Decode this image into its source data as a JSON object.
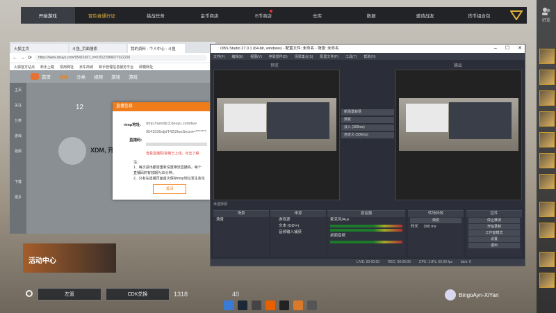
{
  "game_nav": {
    "items": [
      {
        "label": "开始游戏",
        "active": true
      },
      {
        "label": "冒险者通行证",
        "gold": true
      },
      {
        "label": "挑战任务"
      },
      {
        "label": "金币商店"
      },
      {
        "label": "E币商店",
        "badge": true
      },
      {
        "label": "仓库"
      },
      {
        "label": "数据"
      },
      {
        "label": "邀请战友"
      },
      {
        "label": "货币组合包"
      }
    ]
  },
  "right_sidebar": {
    "friend_label": "好友"
  },
  "browser": {
    "tabs": [
      "火狐主页",
      "斗鱼_页面搜索",
      "我的资料 - 个人中心 - 斗鱼"
    ],
    "url": "https://www.douyu.com/9541536?_rt=0.8122966677022226",
    "bookmarks": [
      "火狐官方站点",
      "新手上路",
      "常用网址",
      "京东商城",
      "新手管理信息服务平台",
      "即模网址"
    ],
    "douyu_nav": [
      "首页",
      "直播",
      "分类",
      "视频",
      "游戏",
      "游戏"
    ],
    "side_items": [
      "主页",
      "关注",
      "分类",
      "游戏",
      "视频",
      "",
      "下载",
      "更多"
    ],
    "level": "12",
    "streamer": "XDM, 开",
    "modal": {
      "title": "直播信息",
      "rtmp_label": "rtmp地址:",
      "rtmp_value": "rtmp://sendtc3.douyu.com/live",
      "key_label": "直播码:",
      "key_value": "9541536rdjdT4Zi2lwsSecret=*******",
      "hint": "查看直播码/复制已上线，点击了解",
      "note_title": "注:",
      "notes": [
        "1、每次进出都需重新设置推流直播码，每个",
        "直播码的有效期为15分钟。",
        "2、只有在直播页面首次保存rtmp地址发生变化"
      ],
      "close": "关闭"
    }
  },
  "obs": {
    "title": "OBS Studio 27.0.1 (64-bit, windows) - 配置文件: 未命名 - 场景: 未命名",
    "menu": [
      "文件(F)",
      "编辑(E)",
      "视图(V)",
      "停靠部件(D)",
      "场景集合(S)",
      "配置文件(P)",
      "工具(T)",
      "帮助(H)"
    ],
    "preview_label": "预览",
    "program_label": "输出",
    "transitions": [
      "新场景转场",
      "渐变",
      "淡入 (300ms)",
      "自定义 (300ms)"
    ],
    "no_source": "未选择源",
    "docks": {
      "scenes": {
        "title": "场景",
        "items": [
          "场景"
        ]
      },
      "sources": {
        "title": "来源",
        "items": [
          "游戏源",
          "文本 (GDI+)",
          "音频输入捕获"
        ]
      },
      "mixer": {
        "title": "混音器",
        "items": [
          "麦克风/Aux",
          "桌面音频"
        ]
      },
      "transition": {
        "title": "转场特效",
        "type": "渐变",
        "duration_label": "时长",
        "duration": "300 ms"
      },
      "controls": {
        "title": "控件",
        "buttons": [
          "停止推流",
          "开始录制",
          "工作室模式",
          "设置",
          "退出"
        ]
      }
    },
    "status": {
      "live": "LIVE: 00:00:00",
      "rec": "REC: 00:00:00",
      "cpu": "CPU: 1.8%, 60.00 fps",
      "bitrate": "kb/s: 0"
    }
  },
  "game_hud": {
    "event": "活动中心",
    "hud_buttons": [
      "左篮",
      "CDK兑换"
    ],
    "coins": "1318",
    "coins2": "40",
    "username": "BingoAyn-XiYan"
  },
  "colors": {
    "accent": "#f07c1a",
    "nav_gold": "#e2b23c",
    "obs_bg": "#2b2e38"
  }
}
